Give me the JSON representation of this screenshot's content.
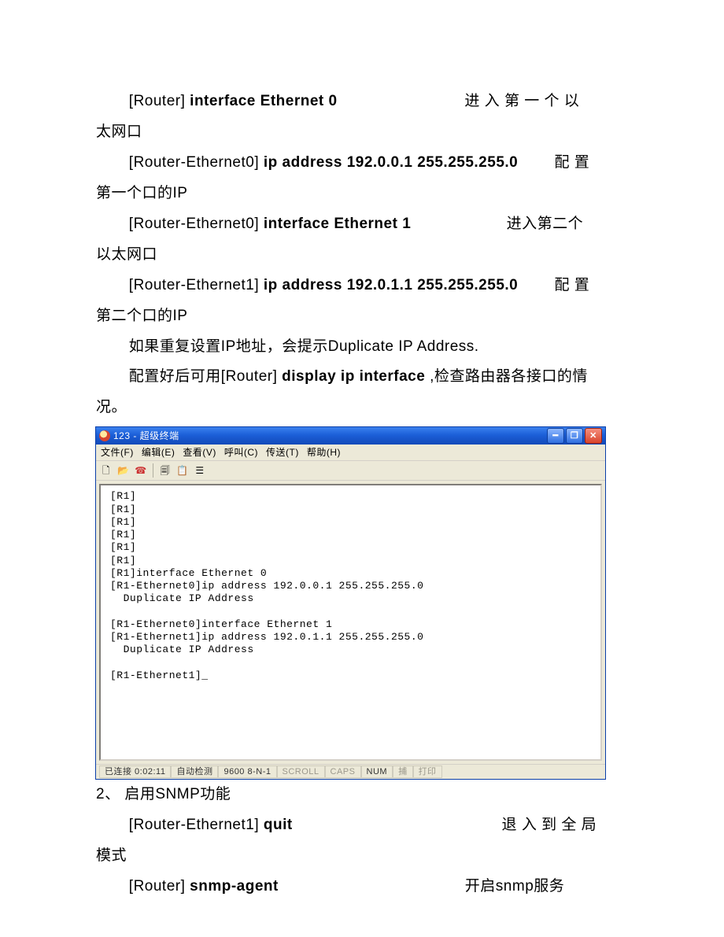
{
  "doc": {
    "lines": [
      {
        "indent": true,
        "prefix": "[Router] ",
        "cmd": "interface Ethernet 0",
        "desc_pad": "                            ",
        "desc": "进 入 第 一 个 以"
      },
      {
        "indent": false,
        "text": "太网口"
      },
      {
        "indent": true,
        "prefix": "[Router-Ethernet0] ",
        "cmd": "ip address 192.0.0.1 255.255.255.0",
        "desc_pad": "        ",
        "desc": "配 置"
      },
      {
        "indent": false,
        "text": "第一个口的IP"
      },
      {
        "indent": true,
        "prefix": "[Router-Ethernet0] ",
        "cmd": "interface Ethernet 1",
        "desc_pad": "                     ",
        "desc": "进入第二个"
      },
      {
        "indent": false,
        "text": "以太网口"
      },
      {
        "indent": true,
        "prefix": "[Router-Ethernet1] ",
        "cmd": "ip address 192.0.1.1 255.255.255.0",
        "desc_pad": "        ",
        "desc": "配 置"
      },
      {
        "indent": false,
        "text": "第二个口的IP"
      },
      {
        "indent": true,
        "text": "如果重复设置IP地址，会提示Duplicate IP Address."
      },
      {
        "indent": true,
        "prefix": "配置好后可用[Router] ",
        "cmd": "display ip interface",
        "desc_pad": " ",
        "desc": ",检查路由器各接口的情"
      },
      {
        "indent": false,
        "text": "况。"
      }
    ],
    "after": [
      {
        "indent": false,
        "text": "2、    启用SNMP功能"
      },
      {
        "indent": true,
        "prefix": "[Router-Ethernet1] ",
        "cmd": "quit",
        "desc_pad": "                                              ",
        "desc": "退 入 到 全 局"
      },
      {
        "indent": false,
        "text": "模式"
      },
      {
        "indent": true,
        "prefix": "[Router] ",
        "cmd": "snmp-agent",
        "desc_pad": "                                         ",
        "desc": "开启snmp服务"
      }
    ]
  },
  "window": {
    "title": "123 - 超级终端",
    "menus": [
      "文件(F)",
      "编辑(E)",
      "查看(V)",
      "呼叫(C)",
      "传送(T)",
      "帮助(H)"
    ],
    "terminal_text": "[R1]\n[R1]\n[R1]\n[R1]\n[R1]\n[R1]\n[R1]interface Ethernet 0\n[R1-Ethernet0]ip address 192.0.0.1 255.255.255.0\n  Duplicate IP Address\n\n[R1-Ethernet0]interface Ethernet 1\n[R1-Ethernet1]ip address 192.0.1.1 255.255.255.0\n  Duplicate IP Address\n\n[R1-Ethernet1]_",
    "status": {
      "conn": "已连接 0:02:11",
      "detect": "自动检测",
      "baud": "9600 8-N-1",
      "scroll": "SCROLL",
      "caps": "CAPS",
      "num": "NUM",
      "cap": "捕",
      "print": "打印"
    }
  }
}
